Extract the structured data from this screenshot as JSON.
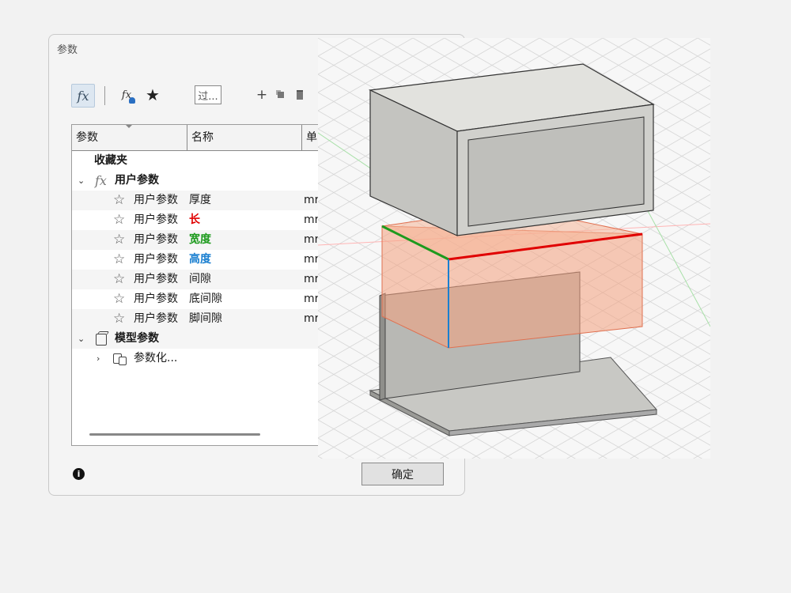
{
  "dialog": {
    "title": "参数",
    "toolbar": {
      "fx_icon": "fx",
      "user_fx_icon": "fx",
      "favorites_icon": "star-icon",
      "filter_text": "过...",
      "add_icon": "plus-icon",
      "copy_icon": "copy-icon",
      "delete_icon": "trash-icon"
    },
    "columns": [
      "参数",
      "名称",
      "单"
    ],
    "groups": {
      "favorites": "收藏夹",
      "user_params": "用户参数",
      "model_params": "模型参数",
      "model_child": "参数化..."
    },
    "rows": [
      {
        "param": "用户参数",
        "name": "厚度",
        "unit": "mr",
        "color": "default"
      },
      {
        "param": "用户参数",
        "name": "长",
        "unit": "mr",
        "color": "red"
      },
      {
        "param": "用户参数",
        "name": "宽度",
        "unit": "mr",
        "color": "green"
      },
      {
        "param": "用户参数",
        "name": "高度",
        "unit": "mr",
        "color": "blue"
      },
      {
        "param": "用户参数",
        "name": "间隙",
        "unit": "mr",
        "color": "default"
      },
      {
        "param": "用户参数",
        "name": "底间隙",
        "unit": "mr",
        "color": "default"
      },
      {
        "param": "用户参数",
        "name": "脚间隙",
        "unit": "mr",
        "color": "default"
      }
    ],
    "ok_label": "确定",
    "info_icon": "info-icon"
  },
  "colors": {
    "length_red": "#e00000",
    "width_green": "#1d9a1d",
    "height_blue": "#1a7fd0",
    "box_fill": "#f4b79a"
  }
}
